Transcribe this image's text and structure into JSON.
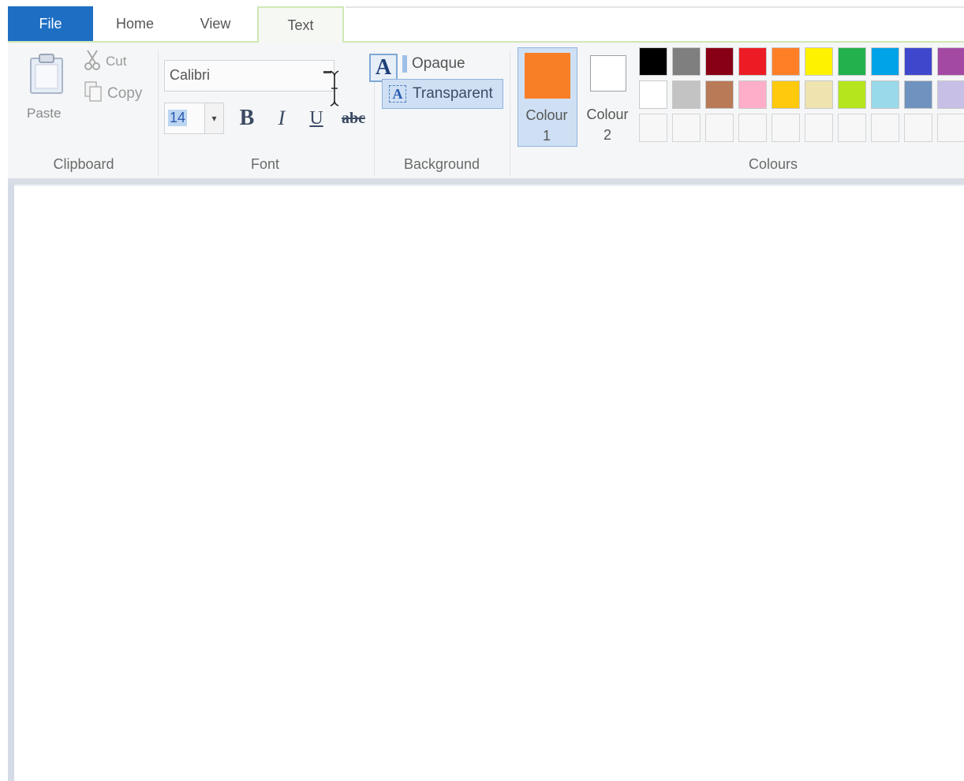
{
  "tabs": {
    "file": "File",
    "home": "Home",
    "view": "View",
    "text": "Text"
  },
  "clipboard": {
    "paste": "Paste",
    "cut": "Cut",
    "copy": "Copy",
    "group_label": "Clipboard"
  },
  "font": {
    "family": "Calibri",
    "size": "14",
    "bold": "B",
    "italic": "I",
    "underline": "U",
    "strikethrough": "abc",
    "group_label": "Font"
  },
  "background": {
    "opaque": "Opaque",
    "transparent": "Transparent",
    "icon_letter": "A",
    "group_label": "Background"
  },
  "colours": {
    "colour1_line1": "Colour",
    "colour1_line2": "1",
    "colour2_line1": "Colour",
    "colour2_line2": "2",
    "colour1_value": "#f97f26",
    "colour2_value": "#ffffff",
    "group_label": "Colours",
    "palette_row1": [
      "#000000",
      "#7f7f7f",
      "#880015",
      "#ed1c24",
      "#ff7f27",
      "#fff200",
      "#22b14c",
      "#00a2e8",
      "#3f48cc",
      "#a349a4"
    ],
    "palette_row2": [
      "#ffffff",
      "#c3c3c3",
      "#b97a57",
      "#ffaec9",
      "#ffc90e",
      "#efe4b0",
      "#b5e61d",
      "#99d9ea",
      "#7092be",
      "#c8bfe7"
    ]
  },
  "icons": {
    "paste": "clipboard-icon",
    "cut": "scissors-icon",
    "copy": "copy-icon",
    "text_cursor": "ibeam-cursor-icon"
  }
}
